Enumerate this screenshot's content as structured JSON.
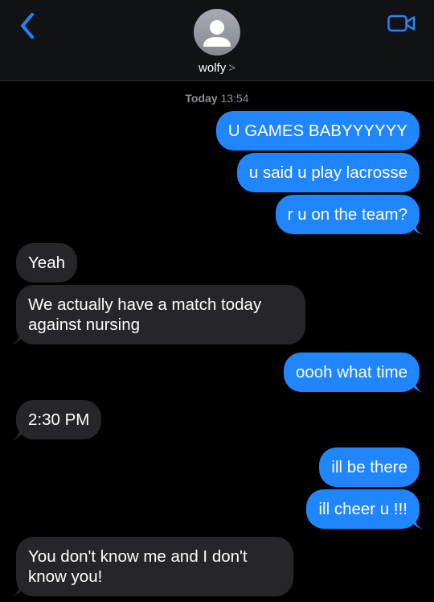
{
  "header": {
    "contact_name": "wolfy",
    "contact_chevron": ">",
    "back_icon": "chevron-left-icon",
    "video_icon": "video-camera-icon",
    "avatar_icon": "person-silhouette-icon",
    "accent_color": "#1f86fe"
  },
  "timestamp": {
    "day": "Today",
    "time": "13:54"
  },
  "messages": [
    {
      "direction": "outgoing",
      "text": "U GAMES BABYYYYYY"
    },
    {
      "direction": "outgoing",
      "text": "u said u play lacrosse"
    },
    {
      "direction": "outgoing",
      "text": "r u on the team?"
    },
    {
      "direction": "incoming",
      "text": "Yeah"
    },
    {
      "direction": "incoming",
      "text": "We actually have a match today against nursing"
    },
    {
      "direction": "outgoing",
      "text": "oooh what time"
    },
    {
      "direction": "incoming",
      "text": "2:30 PM"
    },
    {
      "direction": "outgoing",
      "text": "ill be there"
    },
    {
      "direction": "outgoing",
      "text": "ill cheer u !!!"
    },
    {
      "direction": "incoming",
      "text": "You don't know me and I don't know you!"
    }
  ],
  "colors": {
    "outgoing_bubble": "#1f86fe",
    "incoming_bubble": "#262628",
    "background": "#000000"
  }
}
